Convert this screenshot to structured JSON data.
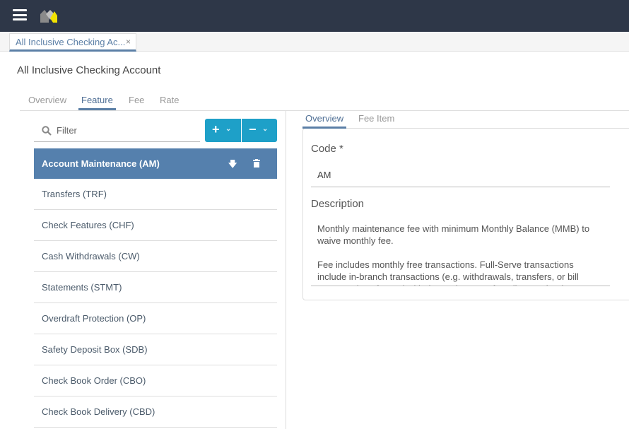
{
  "header": {
    "menu_icon": "hamburger-icon",
    "logo": "app-logo"
  },
  "doc_tab": {
    "label": "All Inclusive Checking Ac...",
    "close": "×"
  },
  "page_title": "All Inclusive Checking Account",
  "tabs": [
    {
      "label": "Overview"
    },
    {
      "label": "Feature"
    },
    {
      "label": "Fee"
    },
    {
      "label": "Rate"
    }
  ],
  "active_tab": "Feature",
  "filter": {
    "placeholder": "Filter"
  },
  "buttons": {
    "add": "+",
    "remove": "−",
    "caret": "⌄"
  },
  "features": [
    {
      "label": "Account Maintenance (AM)",
      "selected": true
    },
    {
      "label": "Transfers (TRF)"
    },
    {
      "label": "Check Features (CHF)"
    },
    {
      "label": "Cash Withdrawals (CW)"
    },
    {
      "label": "Statements (STMT)"
    },
    {
      "label": "Overdraft Protection (OP)"
    },
    {
      "label": "Safety Deposit Box (SDB)"
    },
    {
      "label": "Check Book Order (CBO)"
    },
    {
      "label": "Check Book Delivery (CBD)"
    }
  ],
  "detail": {
    "tabs": [
      {
        "label": "Overview"
      },
      {
        "label": "Fee Item"
      }
    ],
    "code_label": "Code *",
    "code_value": "AM",
    "description_label": "Description",
    "description": [
      "Monthly maintenance fee with minimum Monthly Balance (MMB) to waive monthly fee.",
      "Fee includes monthly free transactions. Full-Serve transactions include in-branch transactions (e.g. withdrawals, transfers, or bill payments) performed with the assistance of a teller or a banker."
    ]
  },
  "colors": {
    "topbar": "#2e3748",
    "accent": "#1ea0c8",
    "selected": "#5580ad"
  }
}
